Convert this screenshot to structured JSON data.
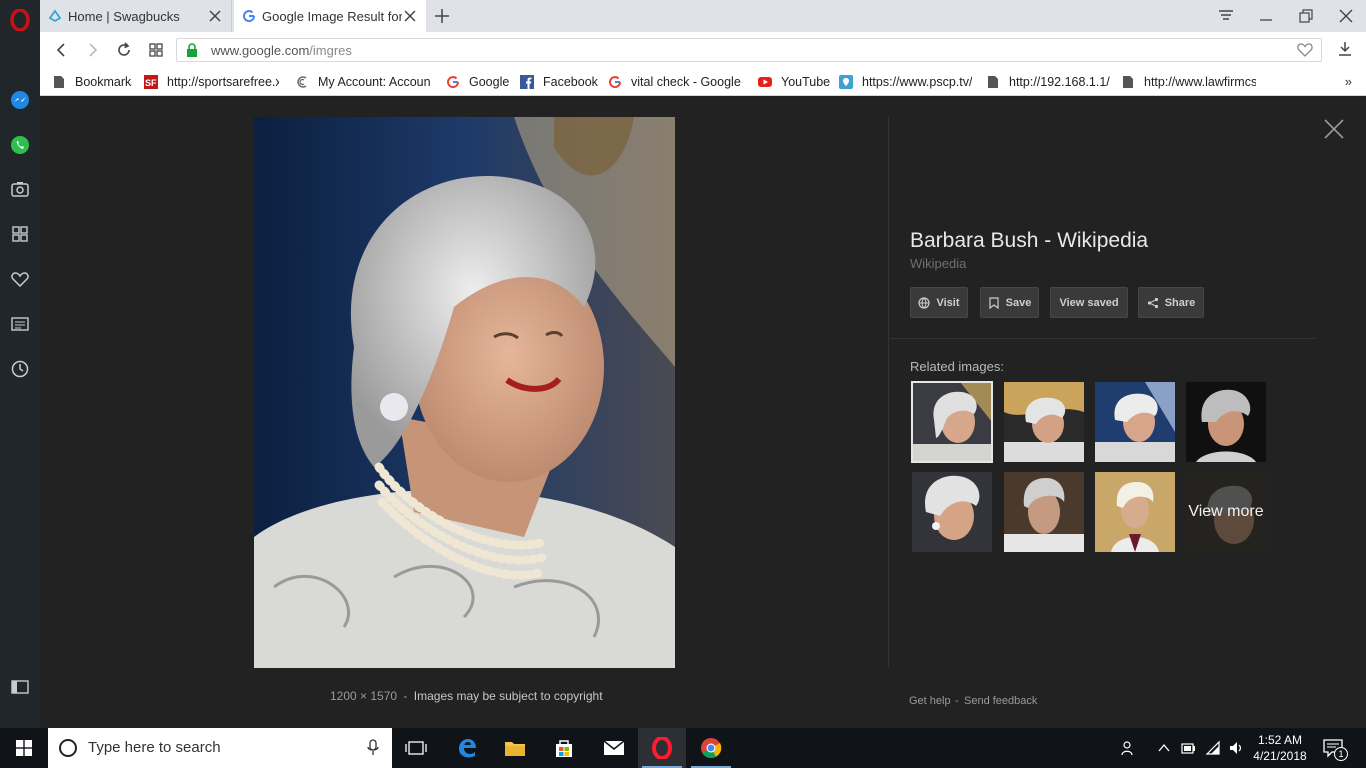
{
  "browser": {
    "tabs": [
      {
        "title": "Home | Swagbucks",
        "active": false
      },
      {
        "title": "Google Image Result for h",
        "active": true
      }
    ],
    "url": {
      "host": "www.google.com",
      "path": "/imgres"
    },
    "bookmarks": [
      {
        "label": "Bookmarks",
        "icon": "page-icon"
      },
      {
        "label": "http://sportsarefree.x",
        "icon": "sf-icon"
      },
      {
        "label": "My Account: Account",
        "icon": "swirl-icon"
      },
      {
        "label": "Google",
        "icon": "google-icon"
      },
      {
        "label": "Facebook",
        "icon": "facebook-icon"
      },
      {
        "label": "vital check - Google S",
        "icon": "google-icon"
      },
      {
        "label": "YouTube",
        "icon": "youtube-icon"
      },
      {
        "label": "https://www.pscp.tv/",
        "icon": "periscope-icon"
      },
      {
        "label": "http://192.168.1.1/",
        "icon": "page-icon"
      },
      {
        "label": "http://www.lawfirmcs",
        "icon": "page-icon"
      }
    ],
    "bookmarks_more": "»"
  },
  "viewer": {
    "title": "Barbara Bush - Wikipedia",
    "source": "Wikipedia",
    "actions": {
      "visit": "Visit",
      "save": "Save",
      "view_saved": "View saved",
      "share": "Share"
    },
    "related_label": "Related images:",
    "view_more": "View more",
    "dimensions": "1200 × 1570",
    "separator": "-",
    "copyright": "Images may be subject to copyright",
    "footer": {
      "help": "Get help",
      "feedback": "Send feedback"
    }
  },
  "taskbar": {
    "search_placeholder": "Type here to search",
    "time": "1:52 AM",
    "date": "4/21/2018",
    "notification_count": "1"
  },
  "colors": {
    "opera_red": "#cc0f16",
    "viewer_bg": "#222222",
    "taskbar_bg": "#101418"
  }
}
